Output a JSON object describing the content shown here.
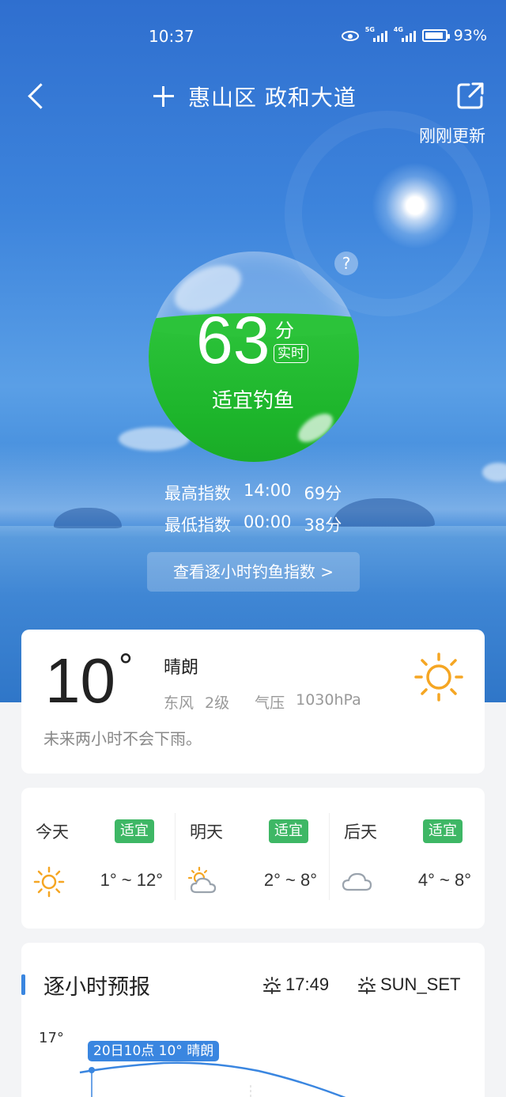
{
  "status_bar": {
    "time": "10:37",
    "net1": "5G",
    "net2": "4G",
    "battery": "93%"
  },
  "header": {
    "location": "惠山区 政和大道",
    "updated": "刚刚更新"
  },
  "fishing": {
    "score": "63",
    "unit": "分",
    "realtime_tag": "实时",
    "suitability": "适宜钓鱼",
    "help": "?",
    "max": {
      "label": "最高指数",
      "time": "14:00",
      "score": "69分"
    },
    "min": {
      "label": "最低指数",
      "time": "00:00",
      "score": "38分"
    },
    "hourly_link": "查看逐小时钓鱼指数  >"
  },
  "current": {
    "temp": "10",
    "deg": "°",
    "condition": "晴朗",
    "wind_dir": "东风",
    "wind_level": "2级",
    "pressure_label": "气压",
    "pressure": "1030hPa",
    "rain_note": "未来两小时不会下雨。",
    "icon": "sun-icon"
  },
  "forecast": [
    {
      "day": "今天",
      "badge": "适宜",
      "range": "1° ~ 12°",
      "icon": "sun-icon"
    },
    {
      "day": "明天",
      "badge": "适宜",
      "range": "2° ~ 8°",
      "icon": "partly-cloudy-icon"
    },
    {
      "day": "后天",
      "badge": "适宜",
      "range": "4° ~ 8°",
      "icon": "cloud-icon"
    }
  ],
  "hourly": {
    "title": "逐小时预报",
    "sunrise_time": "17:49",
    "sunset_label": "SUN_SET",
    "y_label": "17°",
    "tooltip": "20日10点 10° 晴朗"
  },
  "colors": {
    "accent": "#3a86e0",
    "badge_green": "#3eb765",
    "ball_green": "#2cc33a",
    "sun_orange": "#f5a623"
  }
}
